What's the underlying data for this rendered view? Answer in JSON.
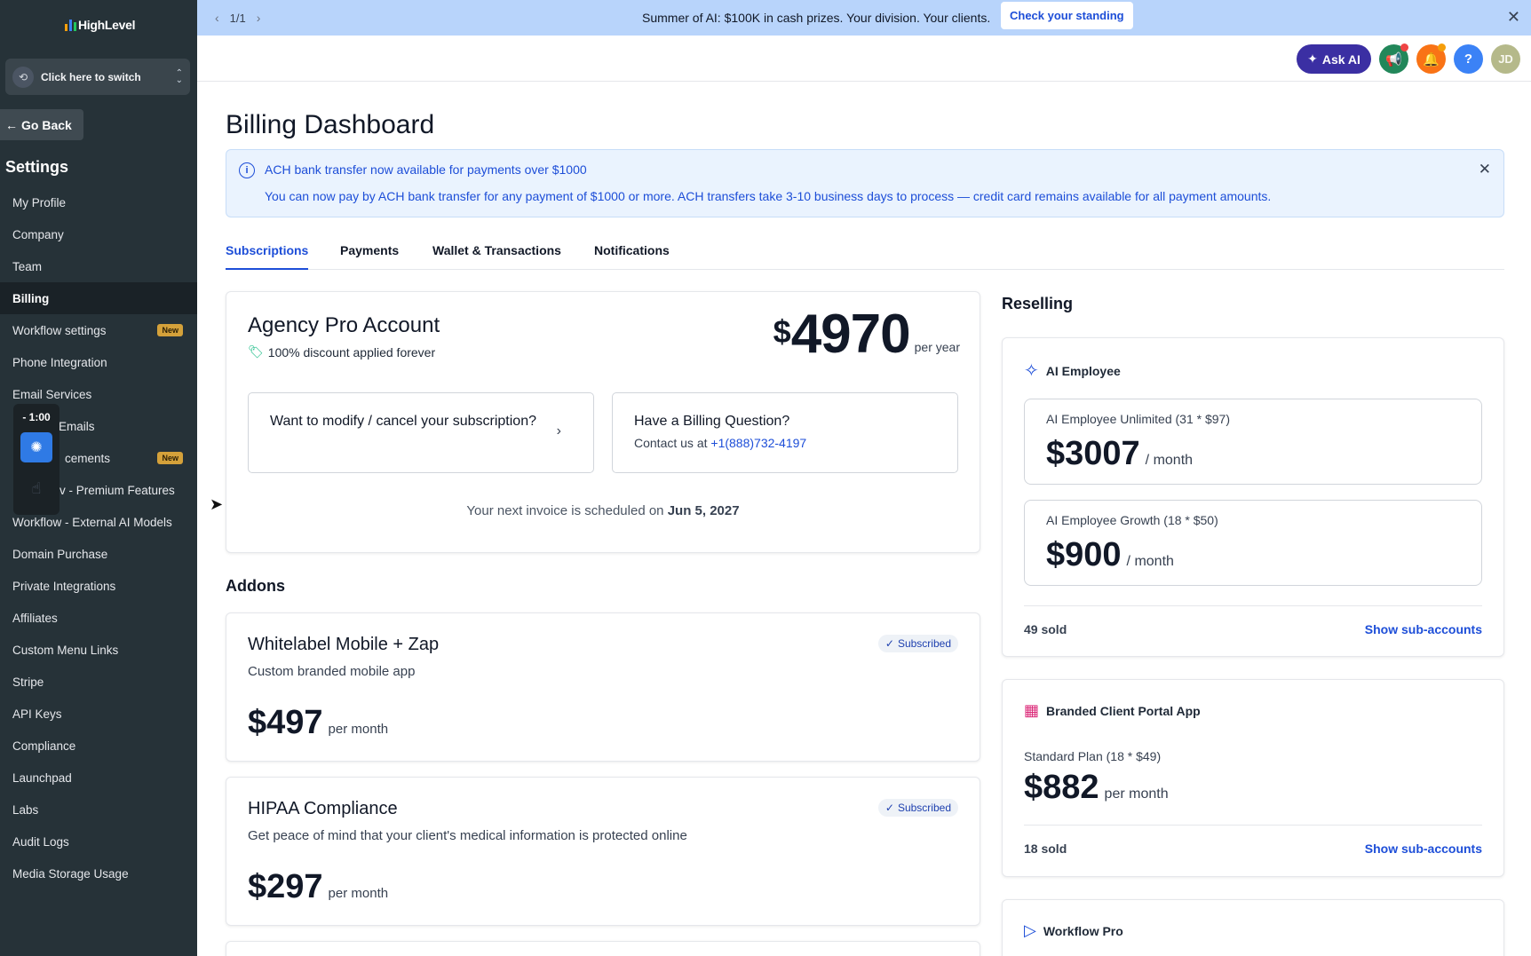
{
  "sidebar": {
    "logo": "HighLevel",
    "switcher_label": "Click here to switch",
    "go_back": "Go Back",
    "settings_heading": "Settings",
    "items": [
      {
        "label": "My Profile",
        "badge": ""
      },
      {
        "label": "Company",
        "badge": ""
      },
      {
        "label": "Team",
        "badge": ""
      },
      {
        "label": "Billing",
        "badge": ""
      },
      {
        "label": "Workflow settings",
        "badge": "New"
      },
      {
        "label": "Phone Integration",
        "badge": ""
      },
      {
        "label": "Email Services",
        "badge": ""
      },
      {
        "label": "Emails",
        "badge": ""
      },
      {
        "label": "cements",
        "badge": "New"
      },
      {
        "label": "v - Premium Features",
        "badge": ""
      },
      {
        "label": "Workflow - External AI Models",
        "badge": ""
      },
      {
        "label": "Domain Purchase",
        "badge": ""
      },
      {
        "label": "Private Integrations",
        "badge": ""
      },
      {
        "label": "Affiliates",
        "badge": ""
      },
      {
        "label": "Custom Menu Links",
        "badge": ""
      },
      {
        "label": "Stripe",
        "badge": ""
      },
      {
        "label": "API Keys",
        "badge": ""
      },
      {
        "label": "Compliance",
        "badge": ""
      },
      {
        "label": "Launchpad",
        "badge": ""
      },
      {
        "label": "Labs",
        "badge": ""
      },
      {
        "label": "Audit Logs",
        "badge": ""
      },
      {
        "label": "Media Storage Usage",
        "badge": ""
      }
    ],
    "active_index": 3
  },
  "timer": {
    "label": "- 1:00"
  },
  "banner": {
    "pager": "1/1",
    "message": "Summer of AI: $100K in cash prizes. Your division. Your clients.",
    "cta": "Check your standing"
  },
  "header": {
    "ask_ai": "Ask AI",
    "help": "?",
    "avatar": "JD"
  },
  "page": {
    "title": "Billing Dashboard",
    "notice": {
      "title": "ACH bank transfer now available for payments over $1000",
      "body": "You can now pay by ACH bank transfer for any payment of $1000 or more. ACH transfers take 3-10 business days to process — credit card remains available for all payment amounts."
    },
    "tabs": [
      "Subscriptions",
      "Payments",
      "Wallet & Transactions",
      "Notifications"
    ],
    "active_tab": 0
  },
  "account": {
    "title": "Agency Pro Account",
    "discount": "100% discount applied forever",
    "currency": "$",
    "price": "4970",
    "period": "per year",
    "modify_text": "Want to modify / cancel your subscription?",
    "billing_q_title": "Have a Billing Question?",
    "billing_q_prefix": "Contact us at",
    "billing_q_phone": "+1(888)732-4197",
    "next_invoice_prefix": "Your next invoice is scheduled on",
    "next_invoice_date": "Jun 5, 2027"
  },
  "addons": {
    "heading": "Addons",
    "items": [
      {
        "title": "Whitelabel Mobile + Zap",
        "desc": "Custom branded mobile app",
        "price": "$497",
        "period": "per month",
        "status": "Subscribed"
      },
      {
        "title": "HIPAA Compliance",
        "desc": "Get peace of mind that your client's medical information is protected online",
        "price": "$297",
        "period": "per month",
        "status": "Subscribed"
      }
    ]
  },
  "reselling": {
    "heading": "Reselling",
    "ai_employee": {
      "name": "AI Employee",
      "plans": [
        {
          "name": "AI Employee Unlimited (31 * $97)",
          "price": "$3007",
          "period": "/ month"
        },
        {
          "name": "AI Employee Growth (18 * $50)",
          "price": "$900",
          "period": "/ month"
        }
      ],
      "sold": "49 sold",
      "link": "Show sub-accounts"
    },
    "client_portal": {
      "name": "Branded Client Portal App",
      "plan_name": "Standard Plan (18 * $49)",
      "price": "$882",
      "period": "per month",
      "sold": "18 sold",
      "link": "Show sub-accounts"
    },
    "workflow_pro": {
      "name": "Workflow Pro"
    }
  },
  "colors": {
    "sidebar_bg": "#263238",
    "banner_bg": "#b8d4fb",
    "accent": "#1d4ed8",
    "ask_ai_bg": "#3b2fa3"
  }
}
